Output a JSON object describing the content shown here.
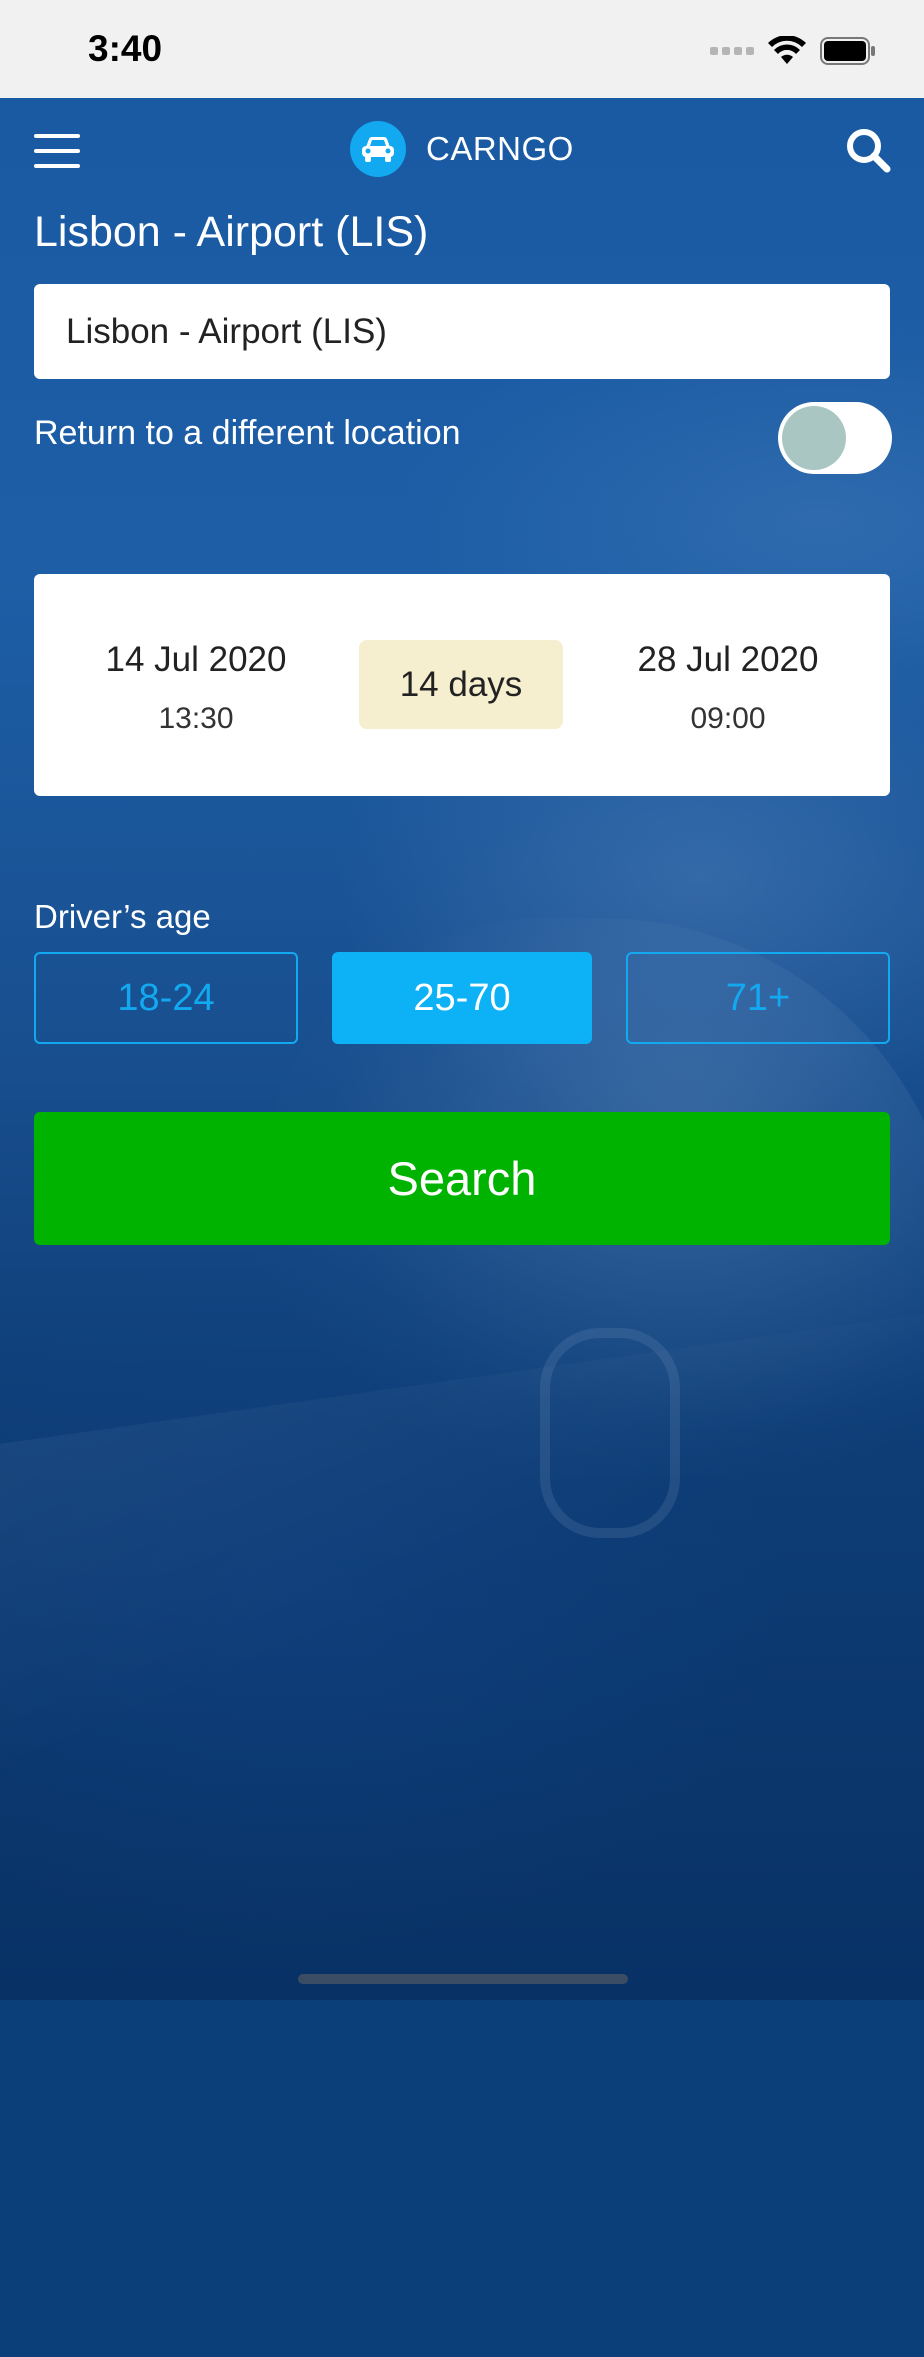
{
  "status_bar": {
    "time": "3:40"
  },
  "header": {
    "brand": "CARNGO"
  },
  "location": {
    "title": "Lisbon - Airport (LIS)",
    "field_value": "Lisbon - Airport (LIS)"
  },
  "return_option": {
    "label": "Return to a different location",
    "enabled": false
  },
  "dates": {
    "pickup_date": "14 Jul 2020",
    "pickup_time": "13:30",
    "duration": "14 days",
    "dropoff_date": "28 Jul 2020",
    "dropoff_time": "09:00"
  },
  "drivers_age": {
    "label": "Driver’s age",
    "options": [
      "18-24",
      "25-70",
      "71+"
    ],
    "selected": "25-70"
  },
  "search_button": {
    "label": "Search"
  },
  "colors": {
    "accent": "#13a9f0",
    "search_green": "#00b300",
    "duration_bg": "#f5efcf",
    "background_blue": "#1a5aa3"
  },
  "icons": [
    "menu-icon",
    "car-icon",
    "search-icon",
    "wifi-icon",
    "battery-icon",
    "signal-icon"
  ]
}
